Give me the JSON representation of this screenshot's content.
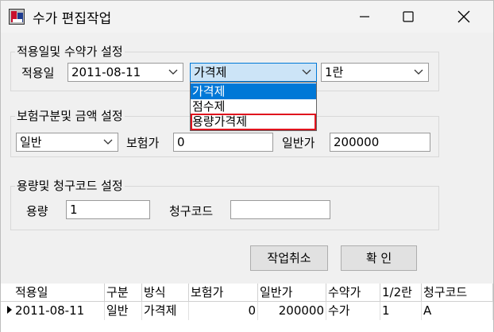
{
  "window": {
    "title": "수가 편집작업"
  },
  "groups": {
    "apply": {
      "title": "적용일및 수약가 설정",
      "date_label": "적용일",
      "date_value": "2011-08-11",
      "method_value": "가격제",
      "method_options": [
        "가격제",
        "점수제",
        "용량가격제"
      ],
      "unit_value": "1란"
    },
    "insurance": {
      "title": "보험구분및 금액 설정",
      "type_value": "일반",
      "insured_label": "보험가",
      "insured_value": "0",
      "general_label": "일반가",
      "general_value": "200000"
    },
    "volume": {
      "title": "용량및 청구코드 설정",
      "volume_label": "용량",
      "volume_value": "1",
      "code_label": "청구코드",
      "code_value": ""
    }
  },
  "buttons": {
    "cancel": "작업취소",
    "ok": "확 인"
  },
  "grid": {
    "headers": [
      "적용일",
      "구분",
      "방식",
      "보험가",
      "일반가",
      "수약가",
      "1/2란",
      "청구코드"
    ],
    "rows": [
      [
        "2011-08-11",
        "일반",
        "가격제",
        "0",
        "200000",
        "수가",
        "1",
        "A"
      ]
    ]
  },
  "colors": {
    "selection": "#0078d7",
    "highlight_box": "#e0141e",
    "active_combo": "#cce4f7"
  },
  "icons": [
    "app-icon",
    "minimize-icon",
    "maximize-icon",
    "close-icon",
    "chevron-down-icon",
    "row-pointer-icon"
  ]
}
